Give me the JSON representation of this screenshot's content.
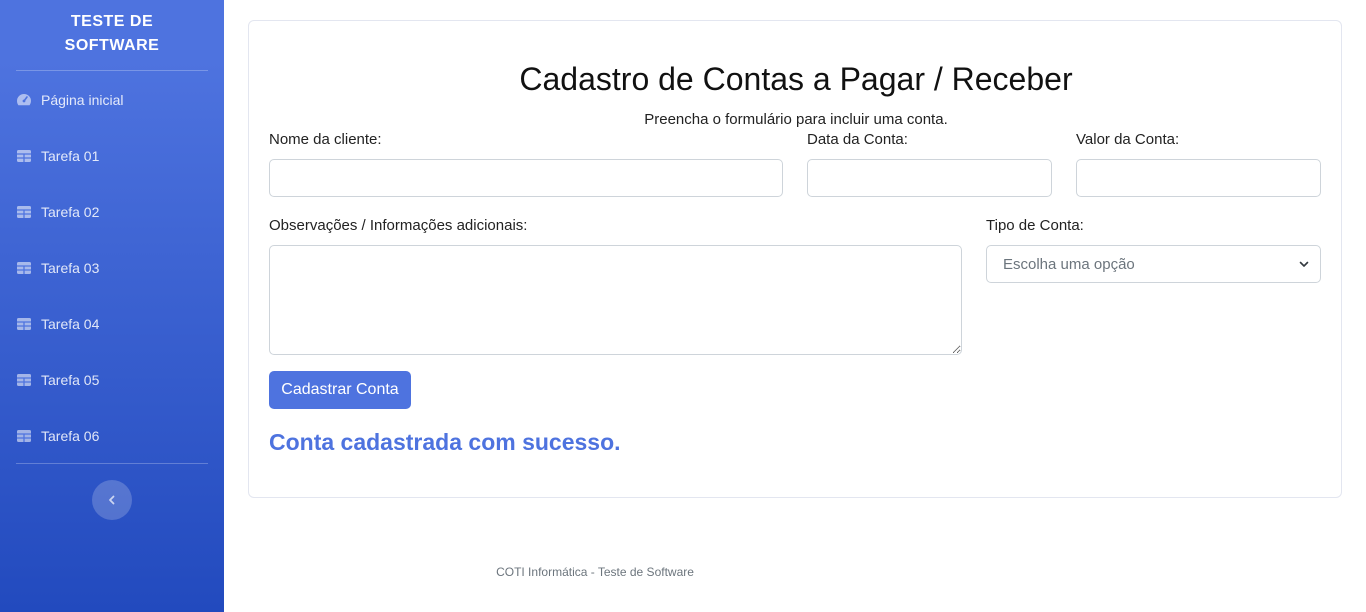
{
  "sidebar": {
    "brand_line1": "TESTE DE",
    "brand_line2": "SOFTWARE",
    "items": [
      {
        "label": "Página inicial",
        "icon": "gauge-icon"
      },
      {
        "label": "Tarefa 01",
        "icon": "table-icon"
      },
      {
        "label": "Tarefa 02",
        "icon": "table-icon"
      },
      {
        "label": "Tarefa 03",
        "icon": "table-icon"
      },
      {
        "label": "Tarefa 04",
        "icon": "table-icon"
      },
      {
        "label": "Tarefa 05",
        "icon": "table-icon"
      },
      {
        "label": "Tarefa 06",
        "icon": "table-icon"
      }
    ],
    "toggle_icon": "chevron-left-icon"
  },
  "form": {
    "title": "Cadastro de Contas a Pagar / Receber",
    "subtitle": "Preencha o formulário para incluir uma conta.",
    "nome_label": "Nome da cliente:",
    "nome_value": "",
    "data_label": "Data da Conta:",
    "data_value": "",
    "valor_label": "Valor da Conta:",
    "valor_value": "",
    "obs_label": "Observações / Informações adicionais:",
    "obs_value": "",
    "tipo_label": "Tipo de Conta:",
    "tipo_selected": "Escolha uma opção",
    "submit_label": "Cadastrar Conta",
    "success_message": "Conta cadastrada com sucesso."
  },
  "footer": {
    "text": "COTI Informática - Teste de Software"
  },
  "colors": {
    "primary": "#4e73df",
    "sidebar_gradient_end": "#224abe",
    "border": "#ced4da"
  }
}
